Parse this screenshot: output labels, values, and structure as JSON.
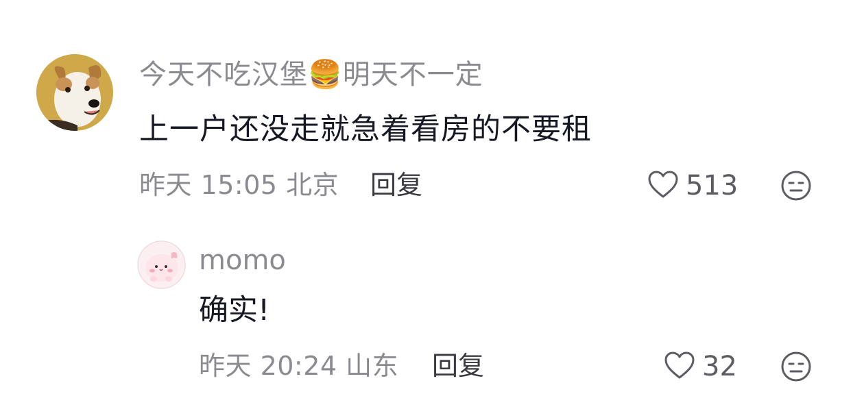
{
  "comments": [
    {
      "username": "今天不吃汉堡🍔明天不一定",
      "avatar_icon": "dog-avatar-icon",
      "content": "上一户还没走就急着看房的不要租",
      "meta": "昨天 15:05 北京",
      "reply_label": "回复",
      "like_count": "513",
      "like_icon": "heart-outline-icon",
      "dislike_icon": "meh-face-icon"
    },
    {
      "username": "momo",
      "avatar_icon": "pink-cartoon-avatar-icon",
      "content": "确实!",
      "meta": "昨天 20:24 山东",
      "reply_label": "回复",
      "like_count": "32",
      "like_icon": "heart-outline-icon",
      "dislike_icon": "meh-face-icon"
    }
  ],
  "colors": {
    "secondary_text": "#8a8b91",
    "primary_text": "#161823",
    "icon_stroke": "#5c5d63",
    "background": "#ffffff"
  }
}
